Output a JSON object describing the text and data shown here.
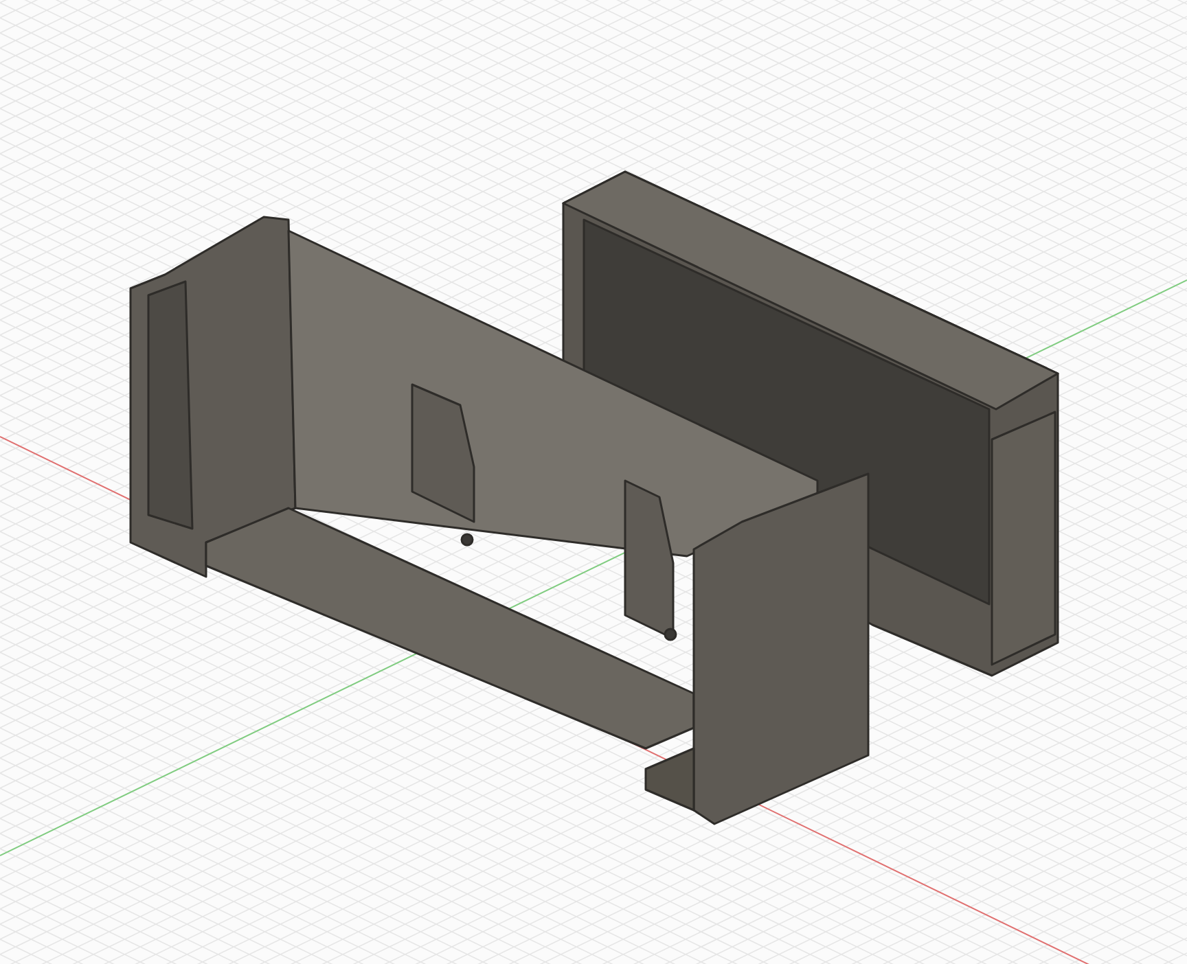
{
  "viewport": {
    "kind": "cad-3d",
    "axes": true,
    "origin": true
  }
}
